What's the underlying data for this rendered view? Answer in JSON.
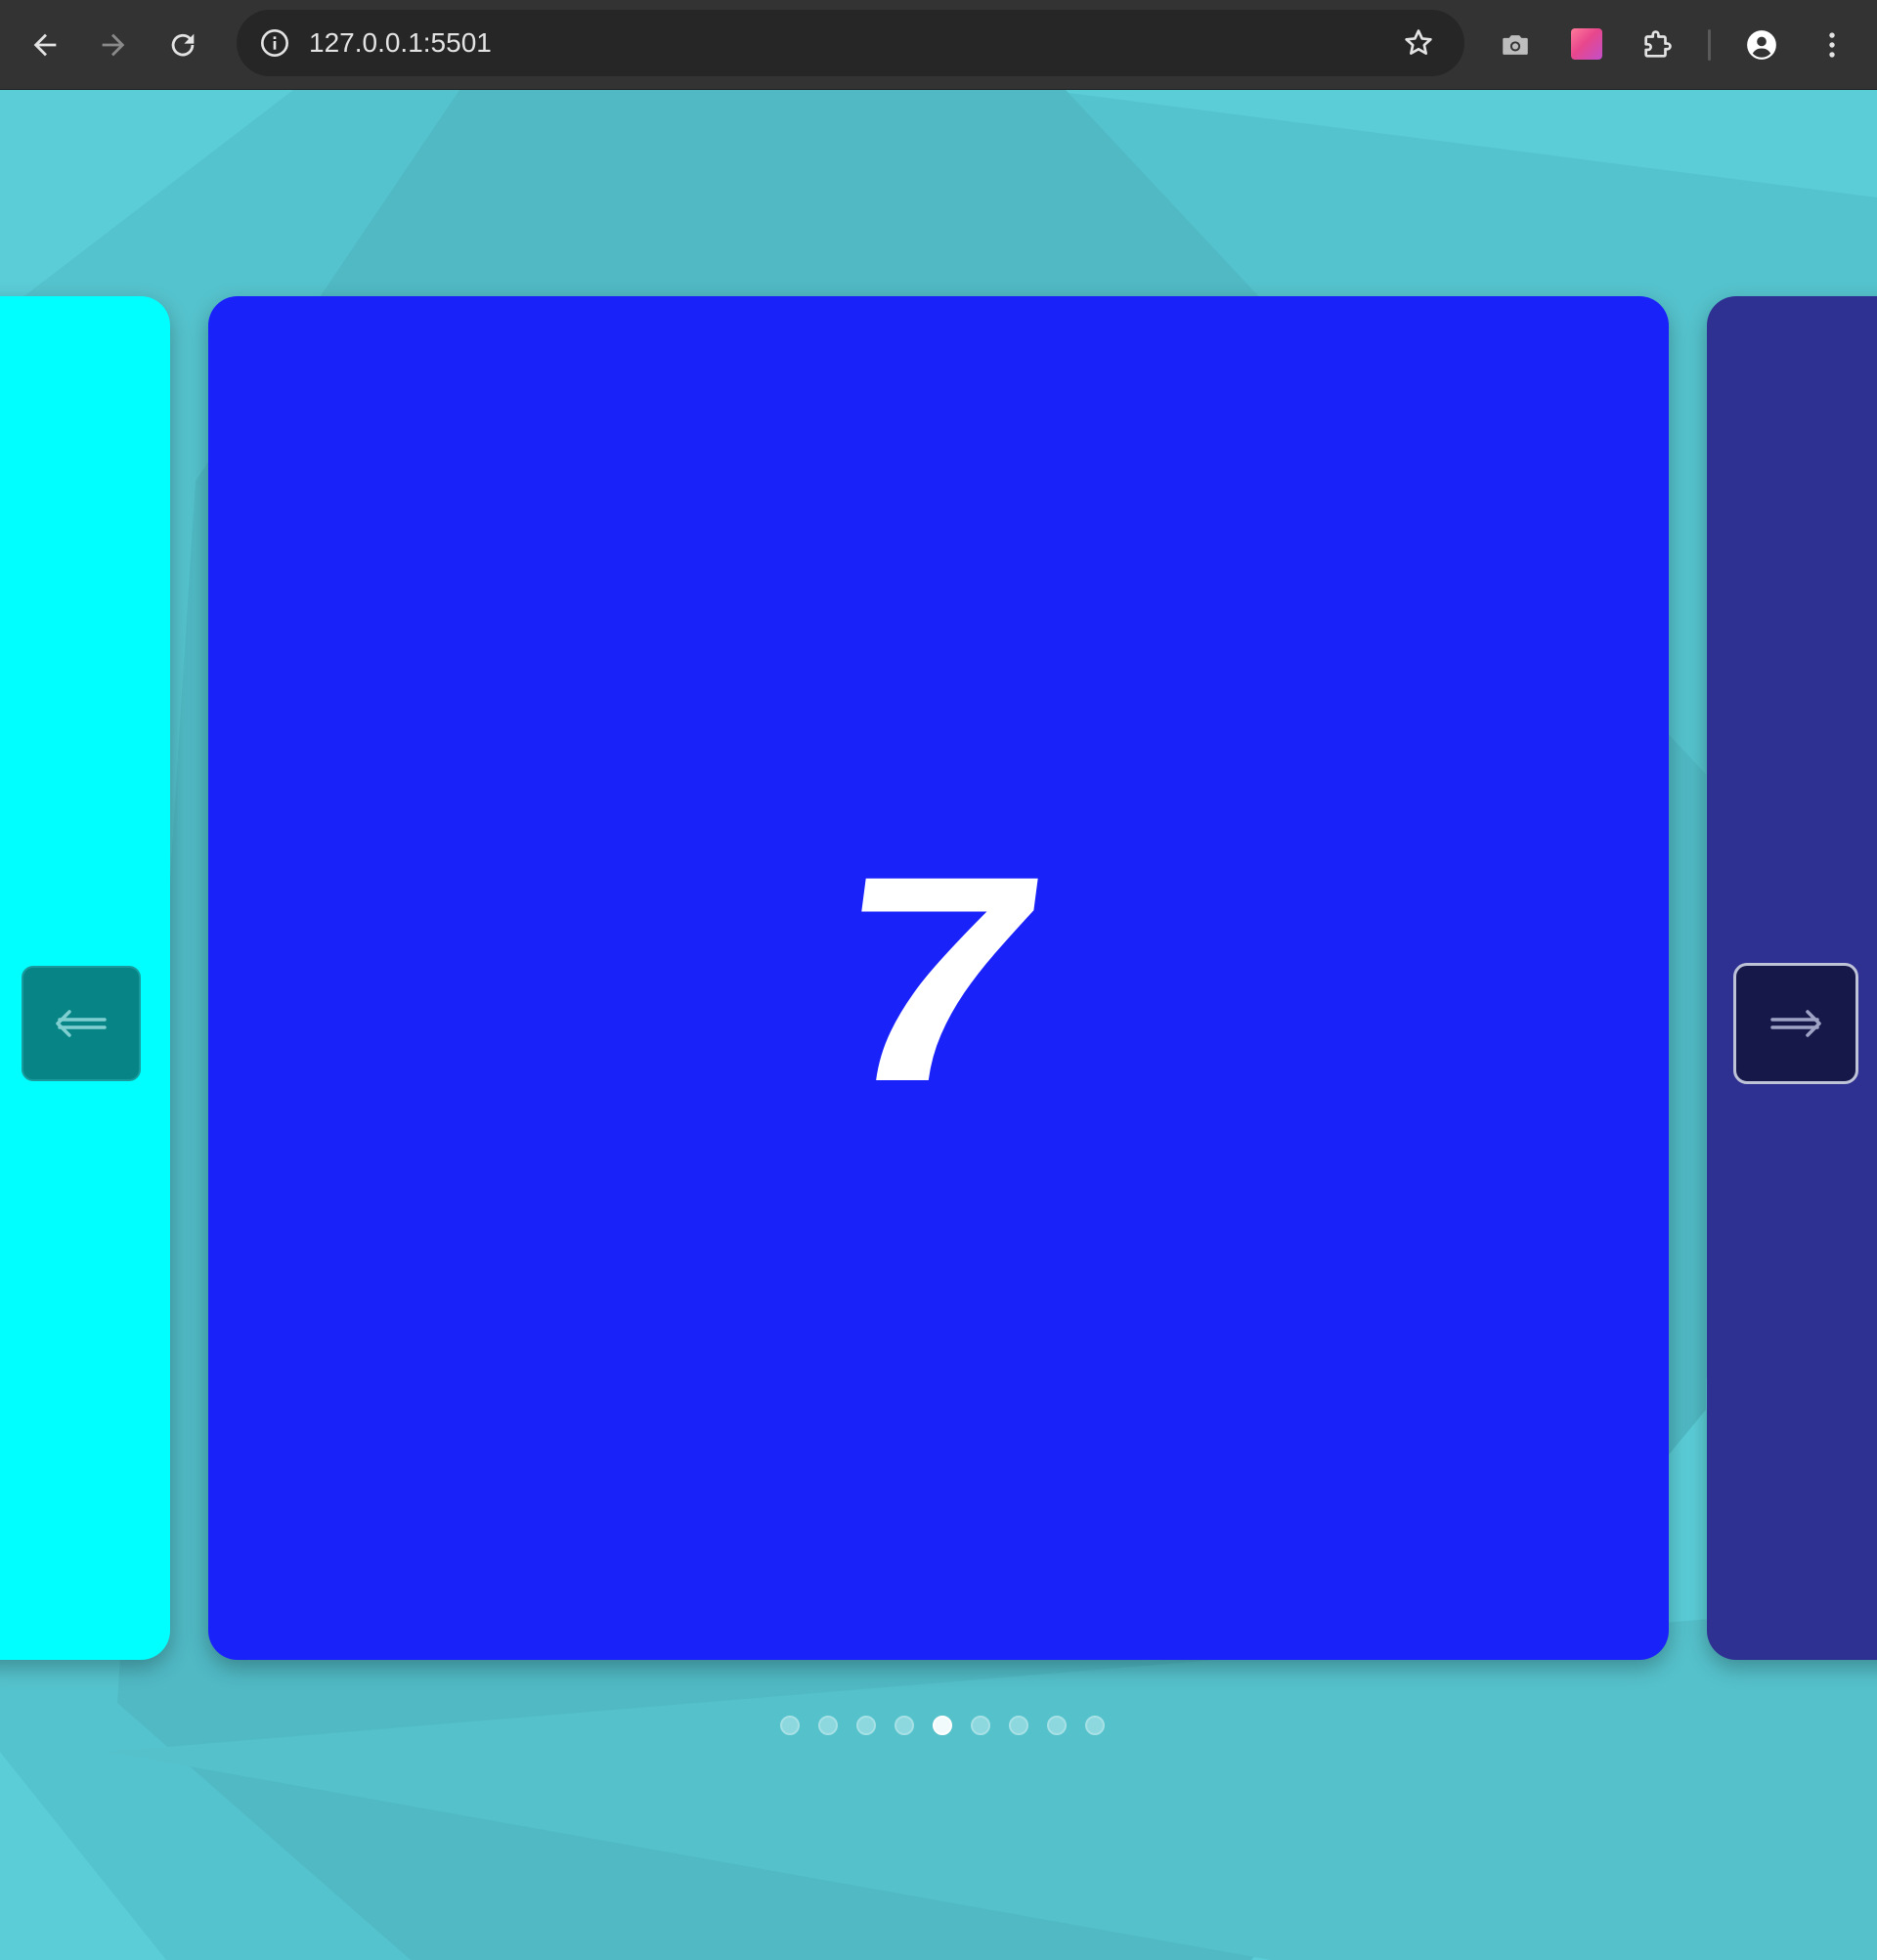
{
  "browser": {
    "url": "127.0.0.1:5501",
    "icons": {
      "back": "back-arrow-icon",
      "forward": "forward-arrow-icon",
      "reload": "reload-icon",
      "site_info": "info-icon",
      "bookmark": "star-icon",
      "camera_extension": "camera-icon",
      "color_extension": "gradient-swatch-icon",
      "extensions": "puzzle-icon",
      "profile": "profile-icon",
      "menu": "kebab-menu-icon"
    }
  },
  "carousel": {
    "current_slide_label": "7",
    "slides": [
      {
        "position": "previous",
        "color": "#00ffff"
      },
      {
        "position": "current",
        "color": "#1a22fa"
      },
      {
        "position": "next",
        "color": "#2f3192"
      }
    ],
    "prev_button_icon": "arrow-left-icon",
    "next_button_icon": "arrow-right-icon",
    "dot_count": 9,
    "active_dot_index": 4
  },
  "colors": {
    "page_background": "#59c9d4",
    "chrome_background": "#333333"
  }
}
